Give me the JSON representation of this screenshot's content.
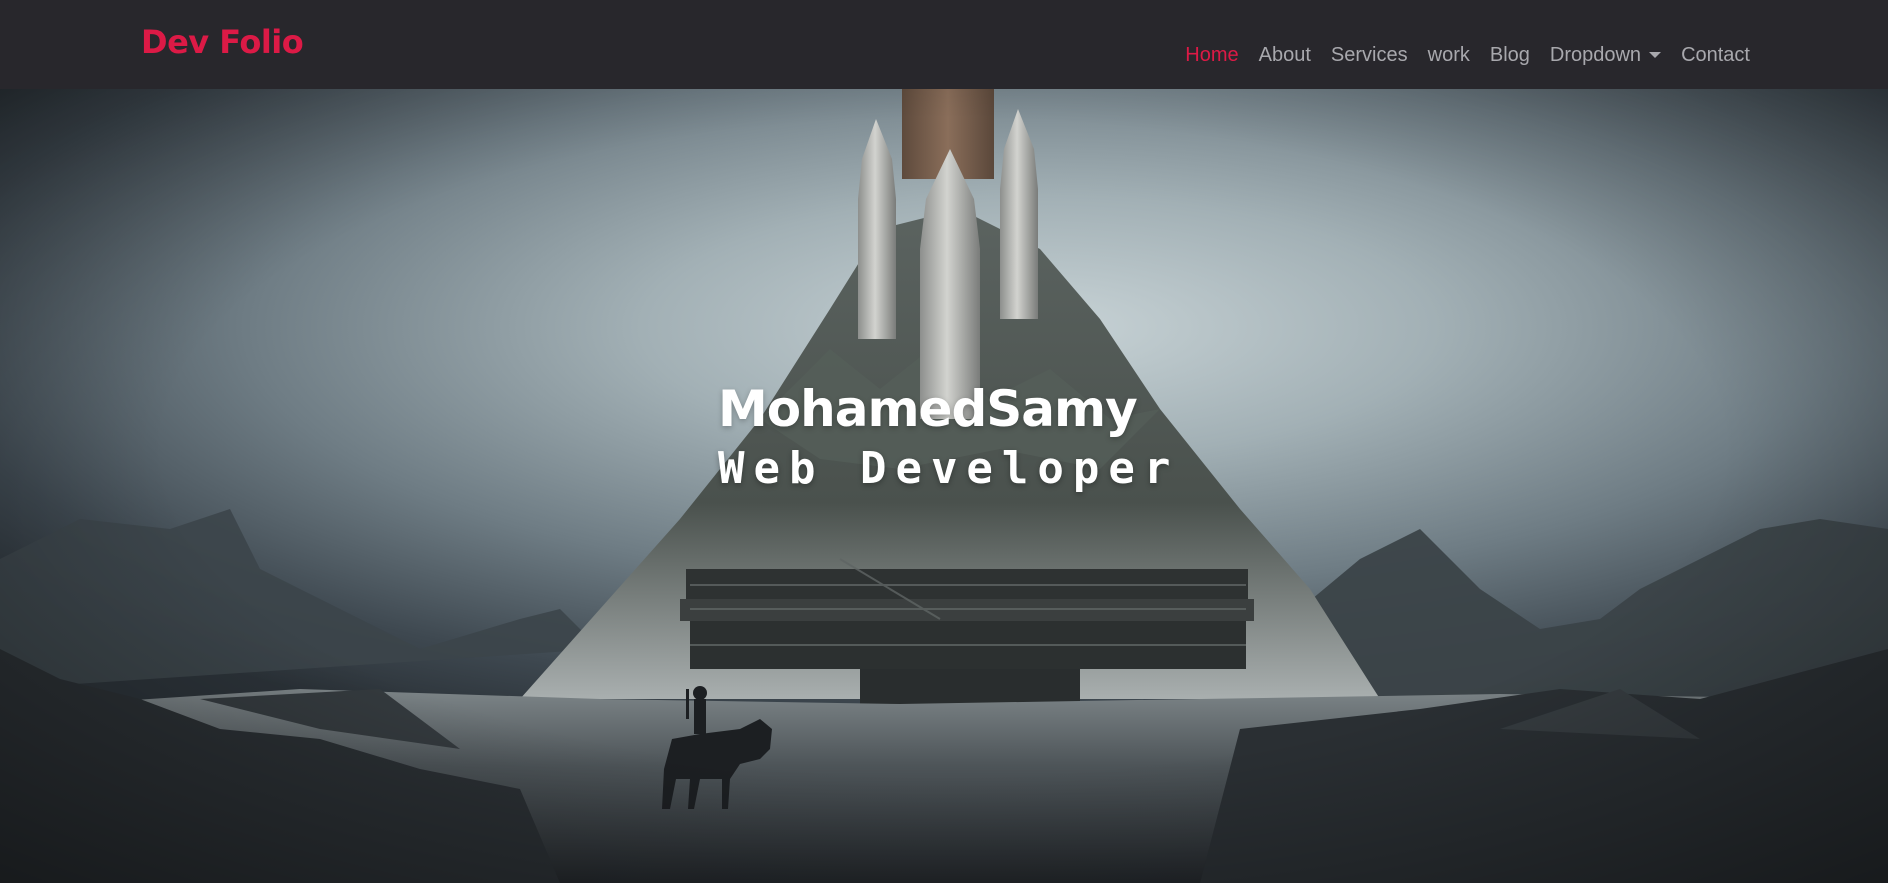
{
  "navbar": {
    "brand": "Dev Folio",
    "items": [
      {
        "label": "Home",
        "active": true
      },
      {
        "label": "About",
        "active": false
      },
      {
        "label": "Services",
        "active": false
      },
      {
        "label": "work",
        "active": false
      },
      {
        "label": "Blog",
        "active": false
      },
      {
        "label": "Dropdown",
        "active": false,
        "icon": "caret-down-icon"
      },
      {
        "label": "Contact",
        "active": false
      }
    ]
  },
  "hero": {
    "name": "MohamedSamy",
    "role": "Web Developer",
    "background": "hero-background-image"
  },
  "colors": {
    "accent": "#dc1a46",
    "navbar_bg": "#28272c",
    "nav_text": "#a8a8ad",
    "hero_text": "#ffffff"
  }
}
